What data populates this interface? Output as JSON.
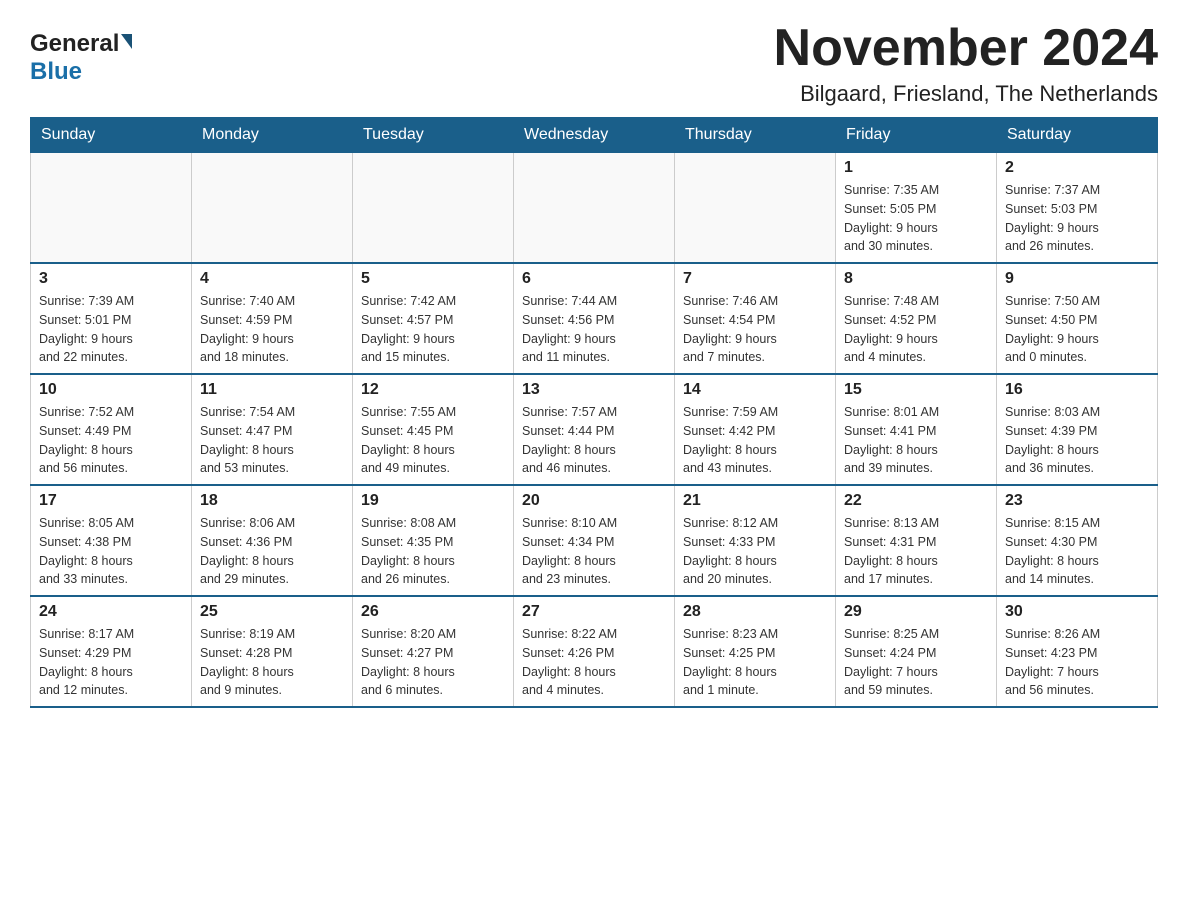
{
  "header": {
    "month_title": "November 2024",
    "subtitle": "Bilgaard, Friesland, The Netherlands",
    "logo_general": "General",
    "logo_blue": "Blue"
  },
  "weekdays": [
    "Sunday",
    "Monday",
    "Tuesday",
    "Wednesday",
    "Thursday",
    "Friday",
    "Saturday"
  ],
  "weeks": [
    [
      {
        "day": "",
        "info": ""
      },
      {
        "day": "",
        "info": ""
      },
      {
        "day": "",
        "info": ""
      },
      {
        "day": "",
        "info": ""
      },
      {
        "day": "",
        "info": ""
      },
      {
        "day": "1",
        "info": "Sunrise: 7:35 AM\nSunset: 5:05 PM\nDaylight: 9 hours\nand 30 minutes."
      },
      {
        "day": "2",
        "info": "Sunrise: 7:37 AM\nSunset: 5:03 PM\nDaylight: 9 hours\nand 26 minutes."
      }
    ],
    [
      {
        "day": "3",
        "info": "Sunrise: 7:39 AM\nSunset: 5:01 PM\nDaylight: 9 hours\nand 22 minutes."
      },
      {
        "day": "4",
        "info": "Sunrise: 7:40 AM\nSunset: 4:59 PM\nDaylight: 9 hours\nand 18 minutes."
      },
      {
        "day": "5",
        "info": "Sunrise: 7:42 AM\nSunset: 4:57 PM\nDaylight: 9 hours\nand 15 minutes."
      },
      {
        "day": "6",
        "info": "Sunrise: 7:44 AM\nSunset: 4:56 PM\nDaylight: 9 hours\nand 11 minutes."
      },
      {
        "day": "7",
        "info": "Sunrise: 7:46 AM\nSunset: 4:54 PM\nDaylight: 9 hours\nand 7 minutes."
      },
      {
        "day": "8",
        "info": "Sunrise: 7:48 AM\nSunset: 4:52 PM\nDaylight: 9 hours\nand 4 minutes."
      },
      {
        "day": "9",
        "info": "Sunrise: 7:50 AM\nSunset: 4:50 PM\nDaylight: 9 hours\nand 0 minutes."
      }
    ],
    [
      {
        "day": "10",
        "info": "Sunrise: 7:52 AM\nSunset: 4:49 PM\nDaylight: 8 hours\nand 56 minutes."
      },
      {
        "day": "11",
        "info": "Sunrise: 7:54 AM\nSunset: 4:47 PM\nDaylight: 8 hours\nand 53 minutes."
      },
      {
        "day": "12",
        "info": "Sunrise: 7:55 AM\nSunset: 4:45 PM\nDaylight: 8 hours\nand 49 minutes."
      },
      {
        "day": "13",
        "info": "Sunrise: 7:57 AM\nSunset: 4:44 PM\nDaylight: 8 hours\nand 46 minutes."
      },
      {
        "day": "14",
        "info": "Sunrise: 7:59 AM\nSunset: 4:42 PM\nDaylight: 8 hours\nand 43 minutes."
      },
      {
        "day": "15",
        "info": "Sunrise: 8:01 AM\nSunset: 4:41 PM\nDaylight: 8 hours\nand 39 minutes."
      },
      {
        "day": "16",
        "info": "Sunrise: 8:03 AM\nSunset: 4:39 PM\nDaylight: 8 hours\nand 36 minutes."
      }
    ],
    [
      {
        "day": "17",
        "info": "Sunrise: 8:05 AM\nSunset: 4:38 PM\nDaylight: 8 hours\nand 33 minutes."
      },
      {
        "day": "18",
        "info": "Sunrise: 8:06 AM\nSunset: 4:36 PM\nDaylight: 8 hours\nand 29 minutes."
      },
      {
        "day": "19",
        "info": "Sunrise: 8:08 AM\nSunset: 4:35 PM\nDaylight: 8 hours\nand 26 minutes."
      },
      {
        "day": "20",
        "info": "Sunrise: 8:10 AM\nSunset: 4:34 PM\nDaylight: 8 hours\nand 23 minutes."
      },
      {
        "day": "21",
        "info": "Sunrise: 8:12 AM\nSunset: 4:33 PM\nDaylight: 8 hours\nand 20 minutes."
      },
      {
        "day": "22",
        "info": "Sunrise: 8:13 AM\nSunset: 4:31 PM\nDaylight: 8 hours\nand 17 minutes."
      },
      {
        "day": "23",
        "info": "Sunrise: 8:15 AM\nSunset: 4:30 PM\nDaylight: 8 hours\nand 14 minutes."
      }
    ],
    [
      {
        "day": "24",
        "info": "Sunrise: 8:17 AM\nSunset: 4:29 PM\nDaylight: 8 hours\nand 12 minutes."
      },
      {
        "day": "25",
        "info": "Sunrise: 8:19 AM\nSunset: 4:28 PM\nDaylight: 8 hours\nand 9 minutes."
      },
      {
        "day": "26",
        "info": "Sunrise: 8:20 AM\nSunset: 4:27 PM\nDaylight: 8 hours\nand 6 minutes."
      },
      {
        "day": "27",
        "info": "Sunrise: 8:22 AM\nSunset: 4:26 PM\nDaylight: 8 hours\nand 4 minutes."
      },
      {
        "day": "28",
        "info": "Sunrise: 8:23 AM\nSunset: 4:25 PM\nDaylight: 8 hours\nand 1 minute."
      },
      {
        "day": "29",
        "info": "Sunrise: 8:25 AM\nSunset: 4:24 PM\nDaylight: 7 hours\nand 59 minutes."
      },
      {
        "day": "30",
        "info": "Sunrise: 8:26 AM\nSunset: 4:23 PM\nDaylight: 7 hours\nand 56 minutes."
      }
    ]
  ]
}
